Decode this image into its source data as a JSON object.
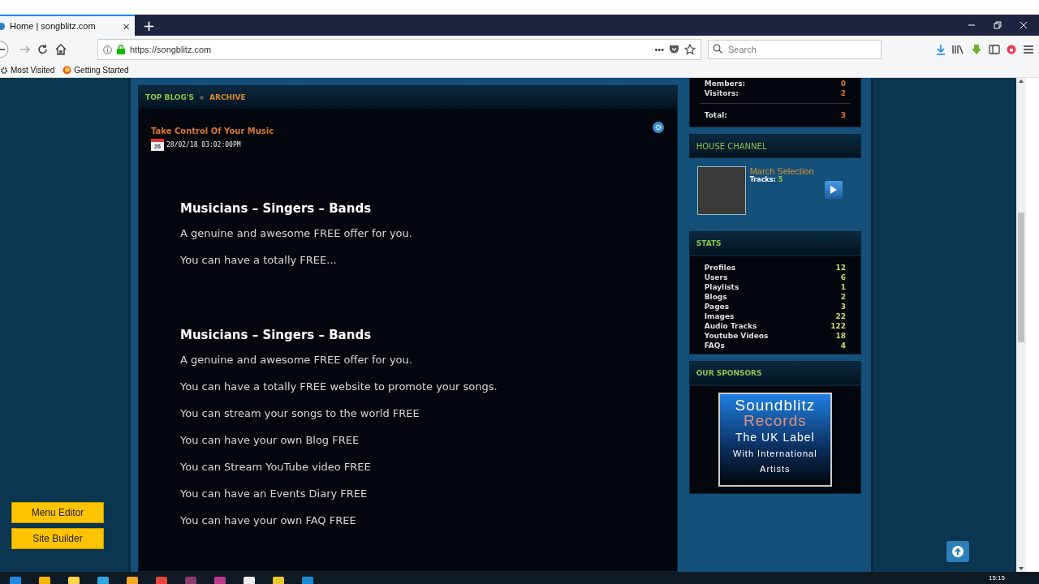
{
  "browser": {
    "tab": {
      "title": "Home | songblitz.com",
      "close": "×",
      "selected": true
    },
    "new_tab": "+",
    "url": "https://songblitz.com",
    "page_actions": "•••",
    "search": {
      "placeholder": "Search"
    },
    "bookmarks": [
      "Most Visited",
      "Getting Started"
    ]
  },
  "blog": {
    "tabs": [
      {
        "label": "TOP BLOG'S",
        "selected": true
      },
      {
        "label": "ARCHIVE",
        "selected": false
      }
    ],
    "post": {
      "title": "Take Control Of Your Music",
      "calendar_day": "26",
      "date": "28/02/18 03:02:00PM"
    },
    "sections": [
      {
        "heading": "Musicians – Singers – Bands",
        "paragraphs": [
          "A genuine and awesome FREE offer for you.",
          "You can have a totally FREE..."
        ]
      },
      {
        "heading": "Musicians – Singers – Bands",
        "paragraphs": [
          "A genuine and awesome FREE offer for you.",
          "You can have a totally FREE website to promote your songs.",
          "You can stream your songs to the world FREE",
          "You can have your own Blog FREE",
          "You can Stream YouTube video FREE",
          "You can have an Events Diary FREE",
          "You can have your own FAQ FREE"
        ]
      }
    ]
  },
  "online": {
    "rows": [
      {
        "label": "Members:",
        "value": "0"
      },
      {
        "label": "Visitors:",
        "value": "2"
      }
    ],
    "total": {
      "label": "Total:",
      "value": "3"
    }
  },
  "house_channel": {
    "title": "HOUSE CHANNEL",
    "playlist": "March Selection",
    "tracks_label": "Tracks:",
    "tracks": "5"
  },
  "stats": {
    "title": "STATS",
    "rows": [
      {
        "label": "Profiles",
        "value": "12"
      },
      {
        "label": "Users",
        "value": "6"
      },
      {
        "label": "Playlists",
        "value": "1"
      },
      {
        "label": "Blogs",
        "value": "2"
      },
      {
        "label": "Pages",
        "value": "3"
      },
      {
        "label": "Images",
        "value": "22"
      },
      {
        "label": "Audio Tracks",
        "value": "122"
      },
      {
        "label": "Youtube Videos",
        "value": "18"
      },
      {
        "label": "FAQs",
        "value": "4"
      }
    ]
  },
  "sponsors": {
    "title": "OUR SPONSORS",
    "banner": [
      "Soundblitz",
      "Records",
      "The UK Label",
      "With International",
      "Artists"
    ]
  },
  "admin_buttons": [
    "Menu Editor",
    "Site Builder"
  ],
  "taskbar": {
    "time": "15:15"
  }
}
